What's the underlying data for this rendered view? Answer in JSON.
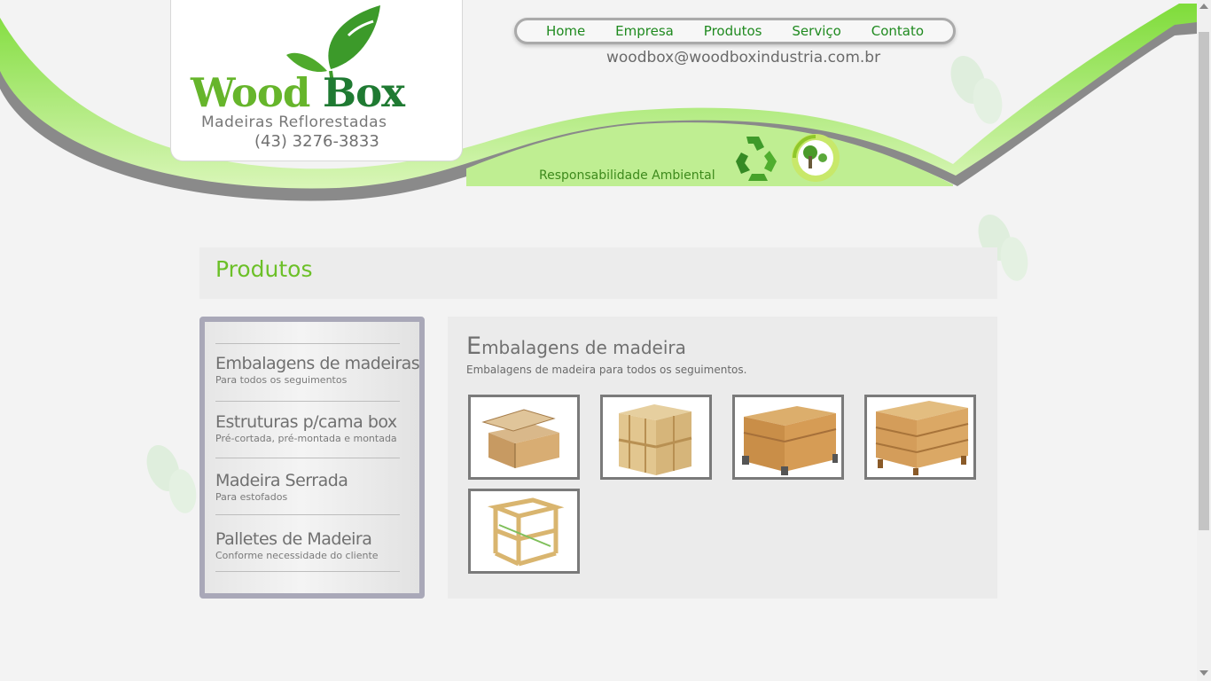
{
  "brand": {
    "name_part1": "Wood",
    "name_part2": "Box",
    "tagline": "Madeiras Reflorestadas",
    "phone": "(43) 3276-3833"
  },
  "nav": {
    "items": [
      {
        "label": "Home"
      },
      {
        "label": "Empresa"
      },
      {
        "label": "Produtos"
      },
      {
        "label": "Serviço"
      },
      {
        "label": "Contato"
      }
    ]
  },
  "header": {
    "email": "woodbox@woodboxindustria.com.br",
    "banner_text": "Responsabilidade Ambiental"
  },
  "page": {
    "title": "Produtos"
  },
  "sidebar": {
    "items": [
      {
        "title": "Embalagens de madeiras",
        "subtitle": "Para todos os seguimentos"
      },
      {
        "title": "Estruturas p/cama box",
        "subtitle": "Pré-cortada, pré-montada e montada"
      },
      {
        "title": "Madeira Serrada",
        "subtitle": "Para estofados"
      },
      {
        "title": "Palletes de Madeira",
        "subtitle": "Conforme necessidade do cliente"
      }
    ]
  },
  "content": {
    "heading_cap": "E",
    "heading_rest": "mbalagens de madeira",
    "description": "Embalagens de madeira para todos os seguimentos."
  },
  "colors": {
    "accent_green": "#6cc028",
    "nav_green": "#1f8a1f",
    "sidebar_border": "#a9a8b8"
  }
}
